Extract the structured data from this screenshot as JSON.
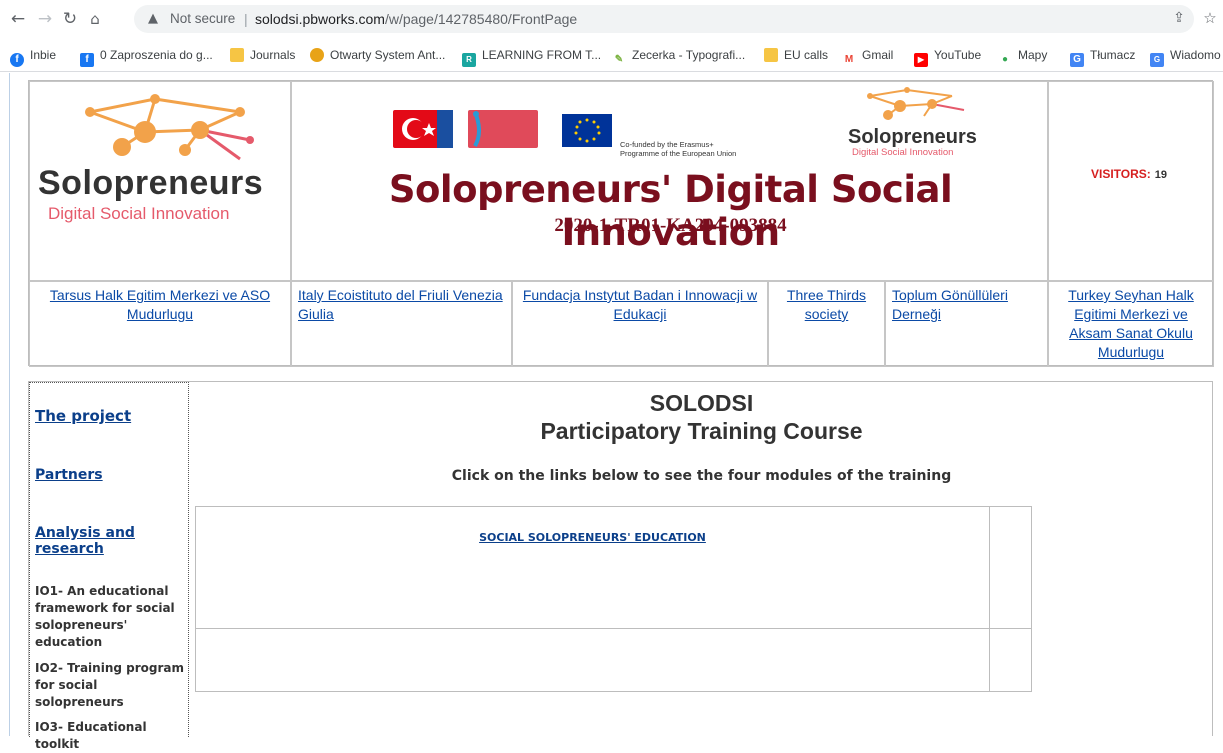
{
  "browser": {
    "not_secure_label": "Not secure",
    "url_host": "solodsi.pbworks.com",
    "url_path": "/w/page/142785480/FrontPage",
    "bookmarks": [
      {
        "label": "Inbie",
        "icon": "facebook-round-icon",
        "color": "#1877f2"
      },
      {
        "label": "0 Zaproszenia do g...",
        "icon": "facebook-square-icon",
        "color": "#1877f2"
      },
      {
        "label": "Journals",
        "icon": "folder-icon",
        "color": "#f6c544"
      },
      {
        "label": "Otwarty System Ant...",
        "icon": "osa-icon",
        "color": "#e8a317"
      },
      {
        "label": "LEARNING FROM T...",
        "icon": "rg-icon",
        "color": "#1aa6a0"
      },
      {
        "label": "Zecerka - Typografi...",
        "icon": "zecerka-icon",
        "color": "#7cb342"
      },
      {
        "label": "EU calls",
        "icon": "folder-icon",
        "color": "#f6c544"
      },
      {
        "label": "Gmail",
        "icon": "gmail-icon",
        "color": "#ea4335"
      },
      {
        "label": "YouTube",
        "icon": "youtube-icon",
        "color": "#ff0000"
      },
      {
        "label": "Mapy",
        "icon": "maps-pin-icon",
        "color": "#34a853"
      },
      {
        "label": "Tłumacz",
        "icon": "translate-icon",
        "color": "#4285f4"
      },
      {
        "label": "Wiadomo",
        "icon": "news-icon",
        "color": "#4285f4"
      }
    ]
  },
  "header": {
    "logo_word": "Solopreneurs",
    "logo_sub": "Digital Social Innovation",
    "eu_text": "Co-funded by the Erasmus+ Programme of the European Union",
    "banner_title": "Solopreneurs' Digital Social Innovation",
    "banner_code": "2020-1-TR01-KA204-093884",
    "visitors_label": "VISITORS:",
    "visitors_count": "19"
  },
  "partners": [
    "Tarsus Halk Egitim Merkezi ve ASO Mudurlugu",
    "Italy Ecoistituto del Friuli Venezia Giulia",
    "Fundacja Instytut Badan i Innowacji w Edukacji",
    "Three Thirds society",
    "Toplum Gönüllüleri Derneği",
    "Turkey Seyhan Halk Egitimi Merkezi ve Aksam Sanat Okulu Mudurlugu"
  ],
  "sidebar": {
    "links": [
      "The project",
      "Partners",
      "Analysis and research"
    ],
    "items": [
      "IO1- An educational framework for social solopreneurs' education",
      "IO2- Training program for social solopreneurs",
      "IO3- Educational toolkit"
    ]
  },
  "main": {
    "title": "SOLODSI",
    "subtitle": "Participatory Training Course",
    "instruction": "Click on the links below to see the four modules of the training",
    "module_link": "SOCIAL SOLOPRENEURS' EDUCATION"
  },
  "colors": {
    "brand_dark_red": "#7a0f1e",
    "logo_orange": "#f2a24a",
    "logo_pink": "#e55a6b",
    "link_blue": "#0b4aa6",
    "visitor_red": "#d62020"
  }
}
